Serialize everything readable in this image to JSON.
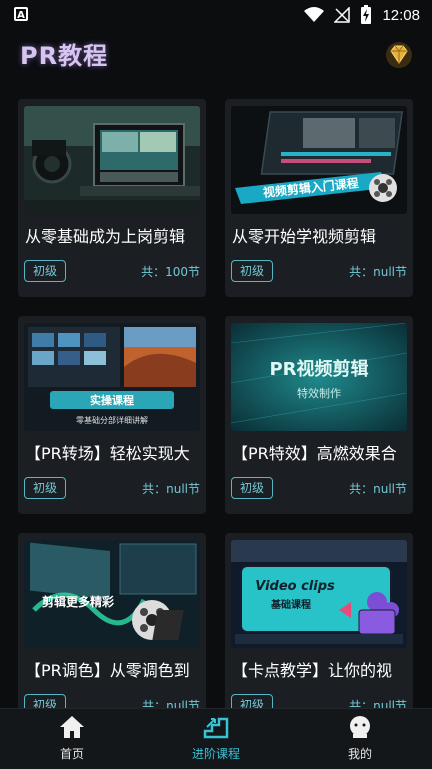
{
  "status_bar": {
    "time": "12:08",
    "app_icon_letter": "A"
  },
  "header": {
    "title": "PR教程",
    "vip_icon": "diamond-icon"
  },
  "courses": [
    {
      "title": "从零基础成为上岗剪辑",
      "level": "初级",
      "count": "共：100节",
      "thumb_text": ""
    },
    {
      "title": "从零开始学视频剪辑",
      "level": "初级",
      "count": "共：null节",
      "thumb_text": "视频剪辑入门课程"
    },
    {
      "title": "【PR转场】轻松实现大",
      "level": "初级",
      "count": "共：null节",
      "thumb_text": "实操课程",
      "thumb_subtext": "零基础分部详细讲解"
    },
    {
      "title": "【PR特效】高燃效果合",
      "level": "初级",
      "count": "共：null节",
      "thumb_text": "PR视频剪辑",
      "thumb_subtext": "特效制作"
    },
    {
      "title": "【PR调色】从零调色到",
      "level": "初级",
      "count": "共：null节",
      "thumb_text": "剪辑更多精彩"
    },
    {
      "title": "【卡点教学】让你的视",
      "level": "初级",
      "count": "共：null节",
      "thumb_text": "Video clips",
      "thumb_subtext": "基础课程"
    }
  ],
  "bottom_nav": {
    "items": [
      {
        "label": "首页",
        "icon": "home-icon"
      },
      {
        "label": "进阶课程",
        "icon": "stairs-icon"
      },
      {
        "label": "我的",
        "icon": "profile-icon"
      }
    ],
    "active_index": 1
  },
  "colors": {
    "accent": "#39c2d6",
    "card_bg": "#1b1f23",
    "page_bg": "#0b0d0f"
  }
}
